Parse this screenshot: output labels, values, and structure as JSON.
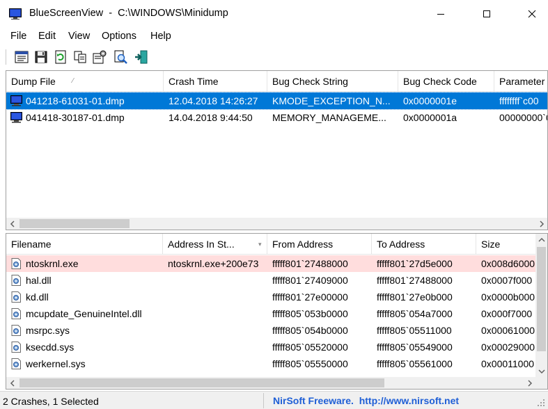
{
  "window": {
    "title": "BlueScreenView  -  C:\\WINDOWS\\Minidump"
  },
  "menu": [
    {
      "label": "File"
    },
    {
      "label": "Edit"
    },
    {
      "label": "View"
    },
    {
      "label": "Options"
    },
    {
      "label": "Help"
    }
  ],
  "toolbar": {
    "buttons": [
      {
        "icon": "properties-window-icon"
      },
      {
        "icon": "save-disk-icon"
      },
      {
        "icon": "refresh-icon"
      },
      {
        "icon": "copy-icon"
      },
      {
        "icon": "html-report-icon"
      },
      {
        "icon": "find-icon"
      },
      {
        "icon": "exit-icon"
      }
    ]
  },
  "crashes": {
    "columns": [
      "Dump File",
      "Crash Time",
      "Bug Check String",
      "Bug Check Code",
      "Parameter"
    ],
    "rows": [
      {
        "dump_file": "041218-61031-01.dmp",
        "crash_time": "12.04.2018 14:26:27",
        "bug_check_string": "KMODE_EXCEPTION_N...",
        "bug_check_code": "0x0000001e",
        "parameter": "ffffffff`c00",
        "selected": true
      },
      {
        "dump_file": "041418-30187-01.dmp",
        "crash_time": "14.04.2018 9:44:50",
        "bug_check_string": "MEMORY_MANAGEME...",
        "bug_check_code": "0x0000001a",
        "parameter": "00000000`0",
        "selected": false
      }
    ]
  },
  "modules": {
    "columns": [
      "Filename",
      "Address In St...",
      "From Address",
      "To Address",
      "Size"
    ],
    "rows": [
      {
        "filename": "ntoskrnl.exe",
        "address_in_stack": "ntoskrnl.exe+200e73",
        "from": "fffff801`27488000",
        "to": "fffff801`27d5e000",
        "size": "0x008d6000",
        "highlight": true
      },
      {
        "filename": "hal.dll",
        "address_in_stack": "",
        "from": "fffff801`27409000",
        "to": "fffff801`27488000",
        "size": "0x0007f000",
        "highlight": false
      },
      {
        "filename": "kd.dll",
        "address_in_stack": "",
        "from": "fffff801`27e00000",
        "to": "fffff801`27e0b000",
        "size": "0x0000b000",
        "highlight": false
      },
      {
        "filename": "mcupdate_GenuineIntel.dll",
        "address_in_stack": "",
        "from": "fffff805`053b0000",
        "to": "fffff805`054a7000",
        "size": "0x000f7000",
        "highlight": false
      },
      {
        "filename": "msrpc.sys",
        "address_in_stack": "",
        "from": "fffff805`054b0000",
        "to": "fffff805`05511000",
        "size": "0x00061000",
        "highlight": false
      },
      {
        "filename": "ksecdd.sys",
        "address_in_stack": "",
        "from": "fffff805`05520000",
        "to": "fffff805`05549000",
        "size": "0x00029000",
        "highlight": false
      },
      {
        "filename": "werkernel.sys",
        "address_in_stack": "",
        "from": "fffff805`05550000",
        "to": "fffff805`05561000",
        "size": "0x00011000",
        "highlight": false
      }
    ]
  },
  "status": {
    "summary": "2 Crashes, 1 Selected",
    "link": "NirSoft Freeware.  http://www.nirsoft.net"
  },
  "colors": {
    "selection": "#0078d7",
    "highlight_row": "#ffdddd",
    "link": "#1f5fd6"
  }
}
